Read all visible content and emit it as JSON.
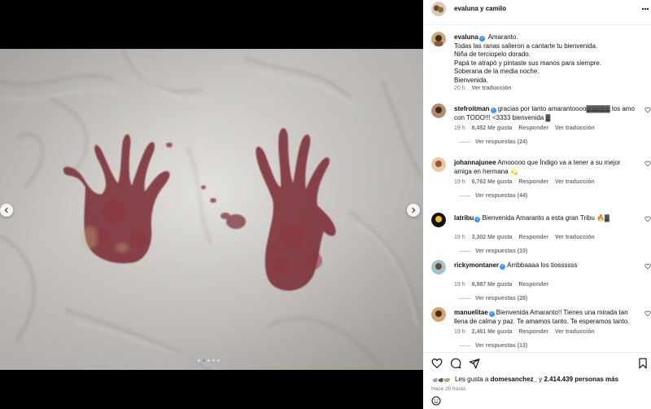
{
  "post": {
    "header_username": "evaluna y camilo",
    "carousel": {
      "slide_count": 5,
      "active_index": 1
    }
  },
  "caption": {
    "username": "evaluna",
    "verified": true,
    "lines": [
      "Amaranto.",
      "Todas las ranas salieron a cantarte tu bienvenida.",
      "Niña de terciopelo dorado.",
      "Papá te atrapó y pintaste sus manos para siempre.",
      "Soberana de la media noche.",
      "Bienvenida."
    ],
    "time": "20 h",
    "translate": "Ver traducción"
  },
  "comments": [
    {
      "username": "stefroitman",
      "verified": true,
      "text": "gracias por tanto amarantoooo▓▓▓▓▓ los amo con TODO!!! <3333 bienvenida ▓",
      "time": "19 h",
      "likes": "8,452 Me gusta",
      "reply": "Responder",
      "translate": "Ver traducción",
      "replies": "Ver respuestas (24)"
    },
    {
      "username": "johannajunee",
      "verified": false,
      "text": "Amooooo que Índigo va a tener a su mejor amiga en hermana 💫",
      "time": "19 h",
      "likes": "6,762 Me gusta",
      "reply": "Responder",
      "translate": "Ver traducción",
      "replies": "Ver respuestas (44)"
    },
    {
      "username": "latribu",
      "verified": true,
      "text": "Bienvenida Amaranto a esta gran Tribu 🔥▓",
      "time": "19 h",
      "likes": "3,302 Me gusta",
      "reply": "Responder",
      "translate": "Ver traducción",
      "replies": "Ver respuestas (10)"
    },
    {
      "username": "rickymontaner",
      "verified": true,
      "text": "Arribbaaaa los tiossssss",
      "time": "19 h",
      "likes": "8,987 Me gusta",
      "reply": "Responder",
      "translate": "",
      "replies": "Ver respuestas (28)"
    },
    {
      "username": "manuelitae",
      "verified": true,
      "text": "Bienvenida Amaranto!! Tienes una mirada tan llena de calma y paz. Te amamos tanto. Te esperamos tanto.",
      "time": "19 h",
      "likes": "2,461 Me gusta",
      "reply": "Responder",
      "translate": "Ver traducción",
      "replies": "Ver respuestas (13)"
    }
  ],
  "actions": {
    "icons": [
      "heart-icon",
      "comment-icon",
      "share-icon",
      "bookmark-icon"
    ],
    "likes_prefix": "Les gusta a",
    "likes_user": "domesanchez_",
    "likes_and": "y",
    "likes_count": "2.414.439 personas más",
    "time_ago": "Hace 20 horas"
  },
  "colors": {
    "verified": "#3897f0",
    "dot_active": "#3ea0ff",
    "muted_text": "#737373",
    "blood": "#7a2a33"
  }
}
